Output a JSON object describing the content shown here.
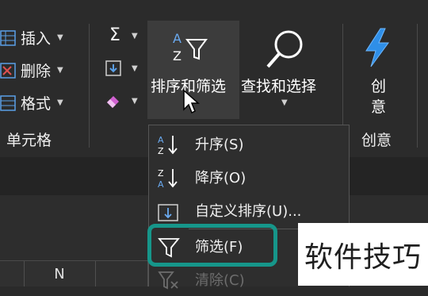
{
  "ribbon": {
    "cells_group": {
      "insert_label": "插入",
      "delete_label": "删除",
      "format_label": "格式",
      "group_label": "单元格"
    },
    "editing_group": {
      "autosum_icon": "sigma-icon",
      "fill_icon": "fill-down-icon",
      "clear_icon": "eraser-icon"
    },
    "sort_filter_button": {
      "label": "排序和筛选",
      "icon": "sort-filter-icon"
    },
    "find_select_button": {
      "label": "查找和选择",
      "icon": "magnifier-icon"
    },
    "creative_group": {
      "button_label_line1": "创",
      "button_label_line2": "意",
      "group_label": "创意",
      "accent_color": "#2f8fe8"
    }
  },
  "dropdown_menu": {
    "items": [
      {
        "label": "升序(S)",
        "icon": "sort-ascending-icon",
        "enabled": true
      },
      {
        "label": "降序(O)",
        "icon": "sort-descending-icon",
        "enabled": true
      },
      {
        "label": "自定义排序(U)...",
        "icon": "custom-sort-icon",
        "enabled": true
      },
      {
        "label": "筛选(F)",
        "icon": "filter-icon",
        "enabled": true,
        "highlighted": true
      },
      {
        "label": "清除(C)",
        "icon": "clear-filter-icon",
        "enabled": false
      }
    ],
    "highlight_color": "#16968a"
  },
  "sheet": {
    "column_headers": [
      "N"
    ]
  },
  "watermark": {
    "text": "软件技巧"
  }
}
